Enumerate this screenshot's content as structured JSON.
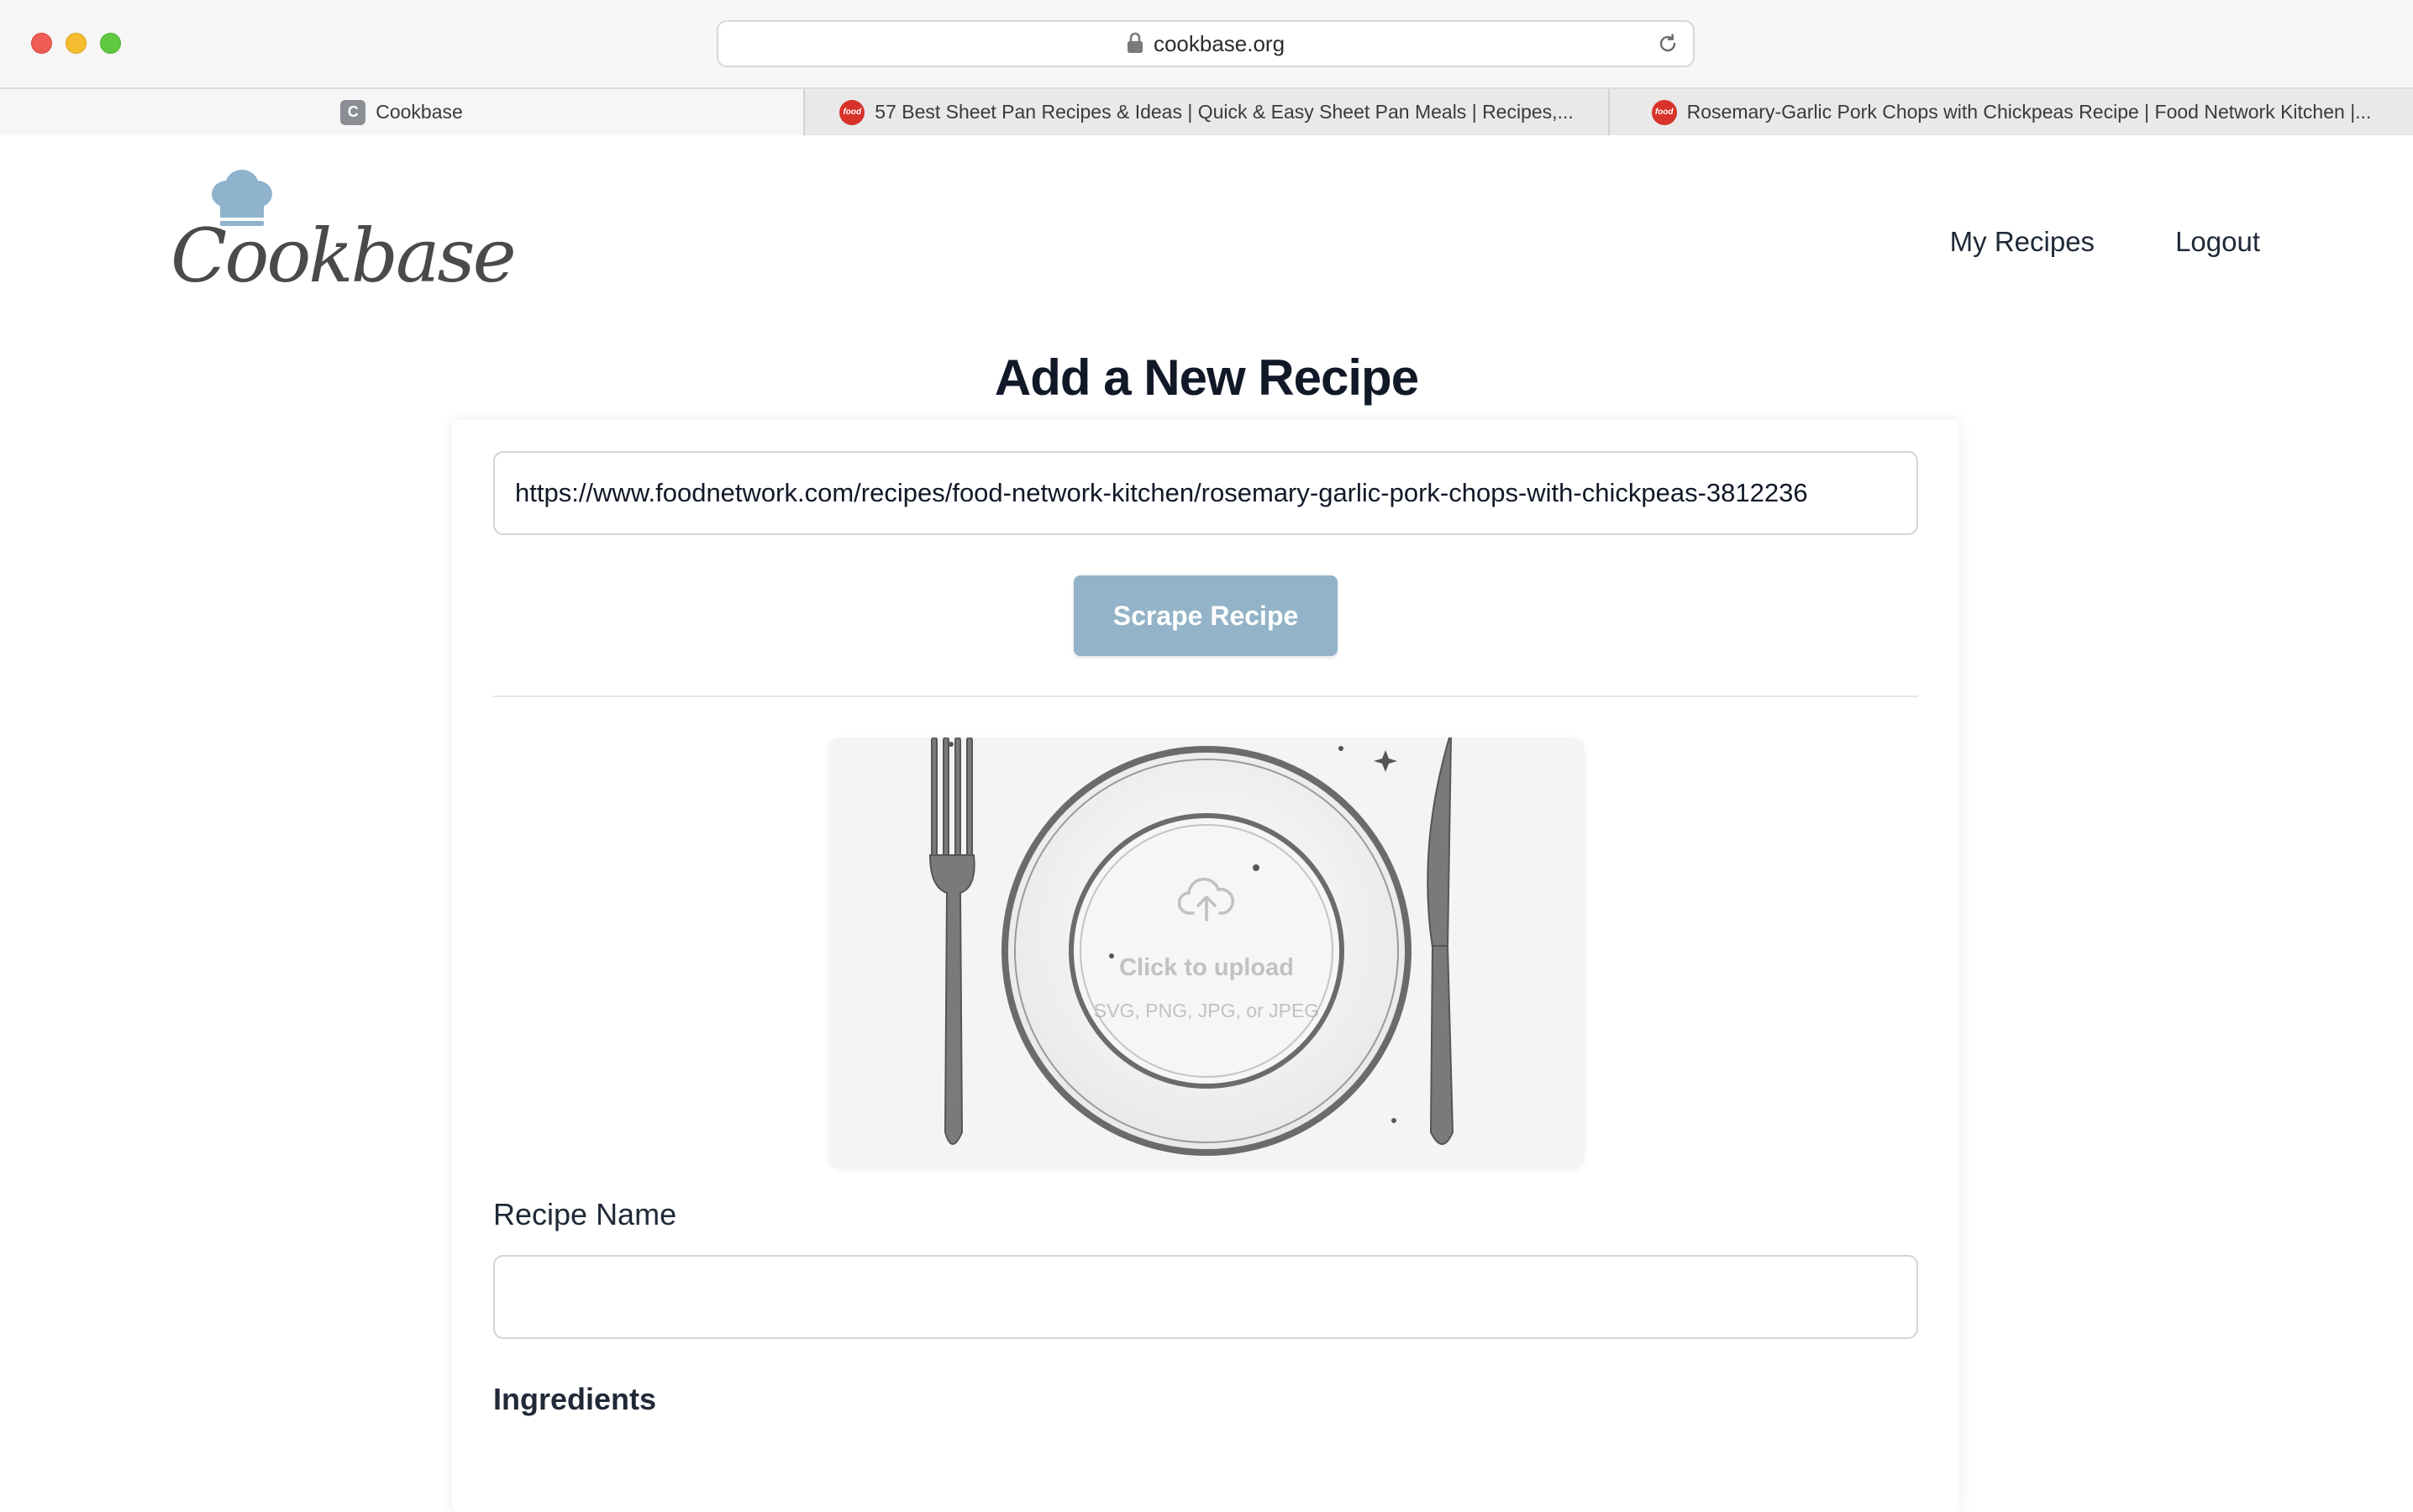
{
  "browser": {
    "url": "cookbase.org",
    "tabs": [
      {
        "label": "Cookbase",
        "favicon": "C",
        "active": true
      },
      {
        "label": "57 Best Sheet Pan Recipes & Ideas | Quick & Easy Sheet Pan Meals | Recipes,...",
        "favicon": "food",
        "active": false
      },
      {
        "label": "Rosemary-Garlic Pork Chops with Chickpeas Recipe | Food Network Kitchen |...",
        "favicon": "food",
        "active": false
      }
    ]
  },
  "site": {
    "logo_text": "Cookbase",
    "nav": {
      "my_recipes": "My Recipes",
      "logout": "Logout"
    }
  },
  "page": {
    "title": "Add a New Recipe",
    "url_value": "https://www.foodnetwork.com/recipes/food-network-kitchen/rosemary-garlic-pork-chops-with-chickpeas-3812236",
    "scrape_button": "Scrape Recipe",
    "upload": {
      "title": "Click to upload",
      "subtitle": "SVG, PNG, JPG, or JPEG"
    },
    "recipe_name_label": "Recipe Name",
    "recipe_name_value": "",
    "ingredients_label": "Ingredients"
  },
  "colors": {
    "accent_button": "#93b3c8",
    "hat": "#8fb3cc",
    "text": "#1f2937"
  }
}
